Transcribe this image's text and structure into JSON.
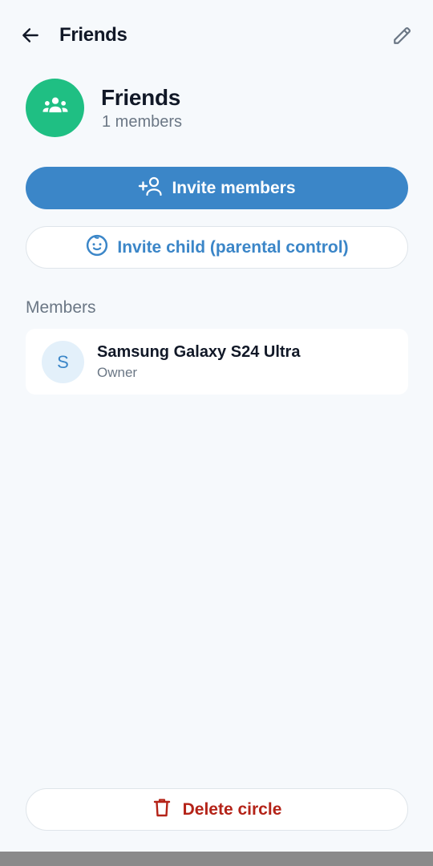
{
  "header": {
    "title": "Friends",
    "back_icon": "arrow-back-icon",
    "edit_icon": "pencil-icon"
  },
  "circle": {
    "name": "Friends",
    "member_count_text": "1 members",
    "icon": "group-icon",
    "color": "#1fbf83"
  },
  "actions": {
    "invite_members_label": "Invite members",
    "invite_members_icon": "person-add-icon",
    "invite_child_label": "Invite child (parental control)",
    "invite_child_icon": "child-face-icon",
    "delete_label": "Delete circle",
    "delete_icon": "trash-icon"
  },
  "members": {
    "section_title": "Members",
    "items": [
      {
        "initial": "S",
        "name": "Samsung Galaxy S24 Ultra",
        "role": "Owner"
      }
    ]
  },
  "colors": {
    "accent": "#3b86c8",
    "danger": "#b42318",
    "background": "#f6f9fc"
  }
}
